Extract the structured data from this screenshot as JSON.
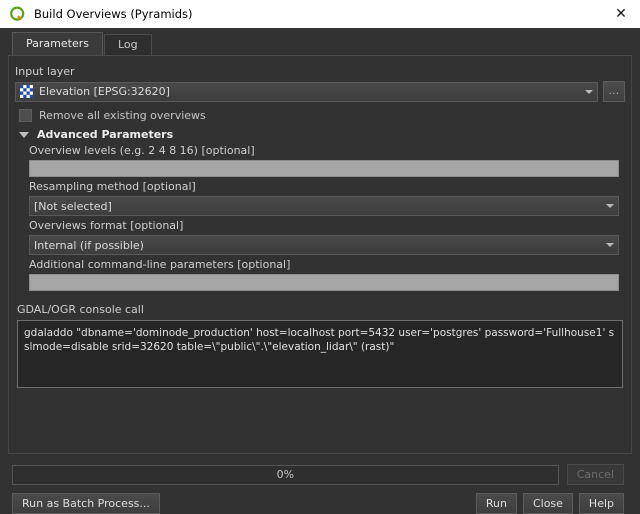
{
  "window": {
    "title": "Build Overviews (Pyramids)",
    "app_icon": "qgis-q-icon",
    "close_icon": "close-icon"
  },
  "tabs": [
    {
      "label": "Parameters",
      "active": true
    },
    {
      "label": "Log",
      "active": false
    }
  ],
  "form": {
    "input_layer": {
      "label": "Input layer",
      "value": "Elevation [EPSG:32620]",
      "layer_icon": "raster-layer-icon",
      "dropdown_icon": "chevron-down-icon",
      "browse_label": "..."
    },
    "remove_existing": {
      "label": "Remove all existing overviews",
      "checked": false
    },
    "advanced": {
      "title": "Advanced Parameters",
      "expanded": true,
      "collapse_icon": "triangle-down-icon"
    },
    "overview_levels": {
      "label": "Overview levels (e.g. 2 4 8 16) [optional]",
      "value": "",
      "placeholder": ""
    },
    "resampling_method": {
      "label": "Resampling method [optional]",
      "value": "[Not selected]",
      "dropdown_icon": "chevron-down-icon"
    },
    "overviews_format": {
      "label": "Overviews format [optional]",
      "value": "Internal (if possible)",
      "dropdown_icon": "chevron-down-icon"
    },
    "additional_params": {
      "label": "Additional command-line parameters [optional]",
      "value": "",
      "placeholder": ""
    },
    "console_call": {
      "label": "GDAL/OGR console call",
      "value": "gdaladdo \"dbname='dominode_production' host=localhost port=5432 user='postgres' password='Fullhouse1' sslmode=disable srid=32620 table=\\\"public\\\".\\\"elevation_lidar\\\" (rast)\""
    }
  },
  "progress": {
    "percent_label": "0%",
    "value": 0
  },
  "buttons": {
    "cancel": {
      "label": "Cancel",
      "enabled": false
    },
    "run_as_batch": {
      "label": "Run as Batch Process...",
      "enabled": true
    },
    "run": {
      "label": "Run",
      "enabled": true
    },
    "close": {
      "label": "Close",
      "enabled": true
    },
    "help": {
      "label": "Help",
      "enabled": true
    }
  }
}
